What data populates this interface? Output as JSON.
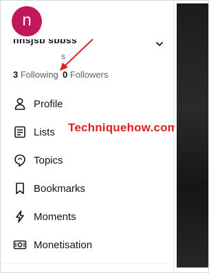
{
  "profile": {
    "avatar_letter": "n",
    "display_name": "nnsjsb sbbss",
    "handle": "s",
    "following_count": "3",
    "following_label": "Following",
    "followers_count": "0",
    "followers_label": "Followers"
  },
  "menu": {
    "items": [
      {
        "label": "Profile",
        "icon": "person-icon"
      },
      {
        "label": "Lists",
        "icon": "list-icon"
      },
      {
        "label": "Topics",
        "icon": "topic-bubble-icon"
      },
      {
        "label": "Bookmarks",
        "icon": "bookmark-icon"
      },
      {
        "label": "Moments",
        "icon": "lightning-icon"
      },
      {
        "label": "Monetisation",
        "icon": "money-icon"
      }
    ]
  },
  "watermark": {
    "text": "Techniquehow.com"
  },
  "colors": {
    "avatar": "#c2185b",
    "watermark": "#e02020",
    "arrow": "#e02020",
    "text": "#0f1419",
    "muted": "#536471"
  }
}
